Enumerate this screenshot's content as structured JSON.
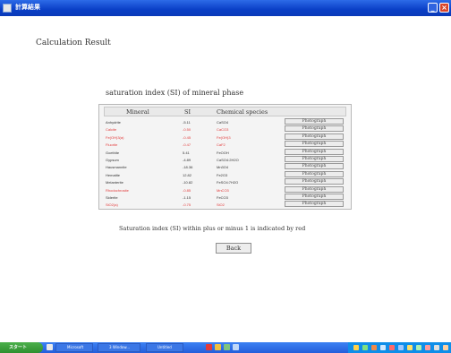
{
  "window": {
    "title": "計算結果"
  },
  "heading": "Calculation Result",
  "subheading": "saturation index (SI) of mineral phase",
  "table": {
    "headers": [
      "Mineral",
      "SI",
      "Chemical species"
    ],
    "button_label": "Photograph",
    "rows": [
      {
        "mineral": "Anhydrite",
        "si": "-5.11",
        "species": "CaSO4",
        "red": false
      },
      {
        "mineral": "Calcite",
        "si": "-0.50",
        "species": "CaCO3",
        "red": true
      },
      {
        "mineral": "Fe(OH)3(a)",
        "si": "-0.45",
        "species": "Fe(OH)3",
        "red": true
      },
      {
        "mineral": "Fluorite",
        "si": "-0.47",
        "species": "CaF2",
        "red": true
      },
      {
        "mineral": "Goethite",
        "si": "5.41",
        "species": "FeOOH",
        "red": false
      },
      {
        "mineral": "Gypsum",
        "si": "-4.89",
        "species": "CaSO4:2H2O",
        "red": false
      },
      {
        "mineral": "Hausmannite",
        "si": "-18.36",
        "species": "Mn3O4",
        "red": false
      },
      {
        "mineral": "Hematite",
        "si": "12.82",
        "species": "Fe2O3",
        "red": false
      },
      {
        "mineral": "Melanterite",
        "si": "-10.82",
        "species": "FeSO4:7H2O",
        "red": false
      },
      {
        "mineral": "Rhodochrosite",
        "si": "-0.85",
        "species": "MnCO3",
        "red": true
      },
      {
        "mineral": "Siderite",
        "si": "-1.15",
        "species": "FeCO3",
        "red": false
      },
      {
        "mineral": "SiO2(a)",
        "si": "-0.75",
        "species": "SiO2",
        "red": true
      }
    ]
  },
  "note": "Saturation index (SI) within plus or minus 1 is indicated by red",
  "back_label": "Back",
  "taskbar": {
    "start_label": "スタート",
    "tasks": [
      "Microsoft",
      "3 Window...",
      "Untitled"
    ]
  },
  "colors": {
    "accent_red": "#e23a3a",
    "titlebar_blue": "#0a3fc6",
    "taskbar_blue": "#245edb",
    "start_green": "#2f8f2f"
  }
}
